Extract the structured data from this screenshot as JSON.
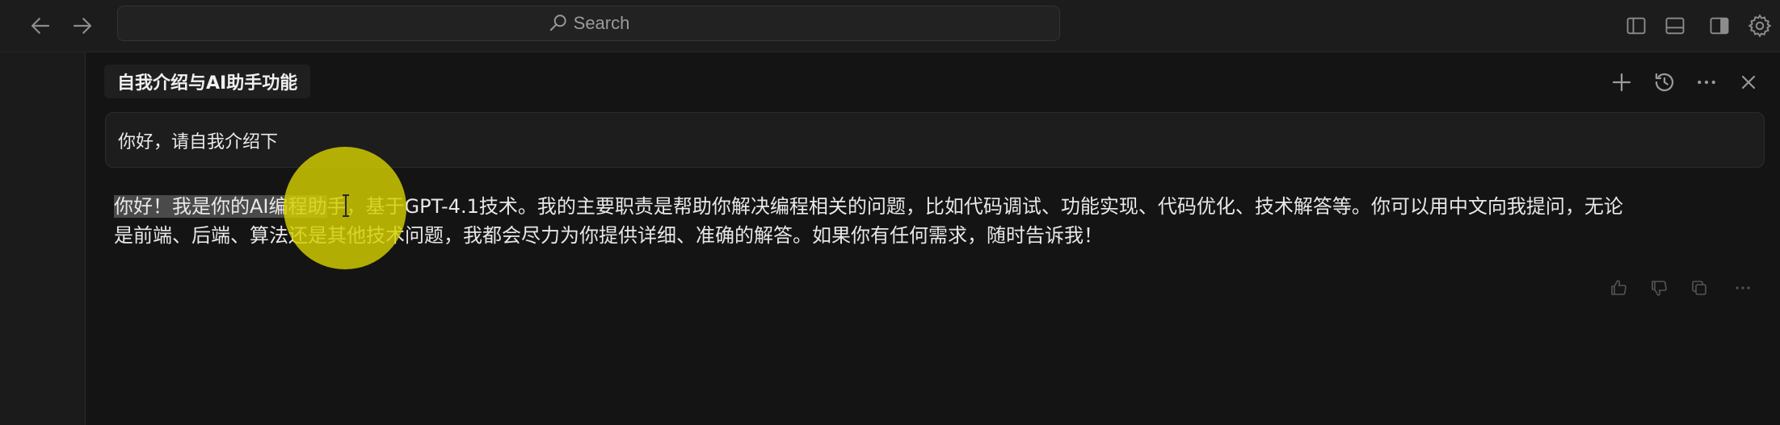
{
  "titlebar": {
    "search_placeholder": "Search",
    "icons": [
      "back-arrow-icon",
      "forward-arrow-icon",
      "search-icon",
      "layout-left-panel-icon",
      "layout-bottom-panel-icon",
      "layout-right-panel-icon",
      "settings-gear-icon"
    ]
  },
  "chat": {
    "title": "自我介绍与AI助手功能",
    "header_icons": [
      "plus-icon",
      "history-icon",
      "more-horizontal-icon",
      "close-icon"
    ],
    "user_message": "你好，请自我介绍下",
    "reply": {
      "highlighted": "你好！我是你的AI编程助",
      "rest_line1": "手，基于GPT-4.1技术。我的主要职责是帮助你解决编程相关的问题，比如代码调试、功能实现、代码优化、技术解答等。你可以用中文向我提问，无论",
      "line2": "是前端、后端、算法还是其他技术问题，我都会尽力为你提供详细、准确的解答。如果你有任何需求，随时告诉我！"
    },
    "action_icons": [
      "thumbs-up-icon",
      "thumbs-down-icon",
      "copy-icon",
      "more-horizontal-icon"
    ]
  },
  "colors": {
    "background": "#141414",
    "titlebar": "#1c1c1c",
    "cursor_highlight": "#d6cf00",
    "selection": "#4a4a4a"
  }
}
